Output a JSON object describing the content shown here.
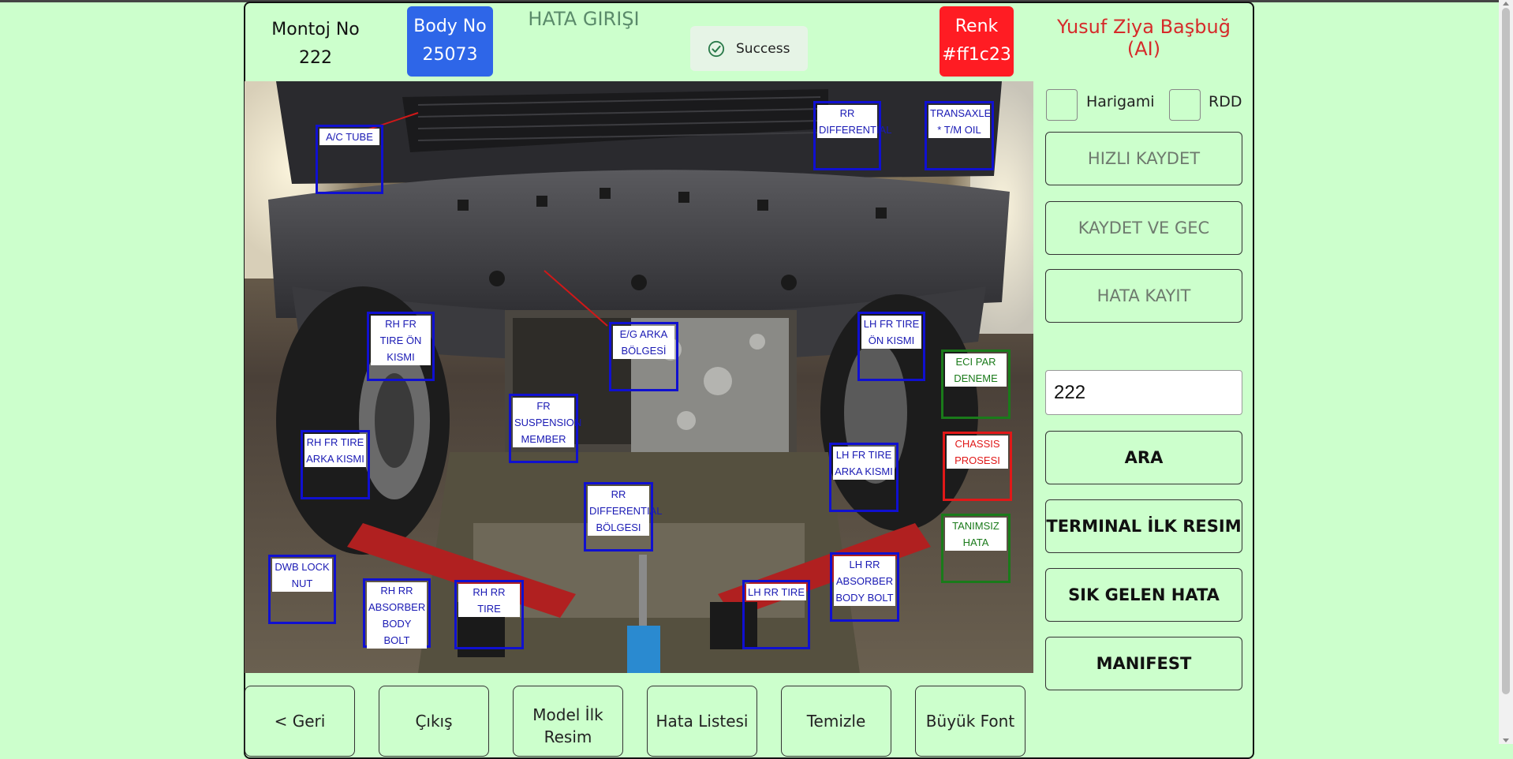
{
  "header": {
    "montoj_label": "Montoj No",
    "montoj_value": "222",
    "body_label": "Body No",
    "body_value": "25073",
    "title": "HATA GIRIŞI",
    "toast_text": "Success",
    "renk_label": "Renk",
    "renk_value": "#ff1c23",
    "user": "Yusuf Ziya Başbuğ (AI)"
  },
  "colors": {
    "page_bg": "#ccffcc",
    "body_badge": "#2e66e8",
    "renk_badge": "#ff1c23",
    "tag_blue": "#1010d0",
    "tag_green": "#1a7a1a",
    "tag_red": "#e01818"
  },
  "tags": {
    "ac_tube": "A/C TUBE",
    "rr_differential": "RR DIFFERENTIAL",
    "transaxle": "TRANSAXLE * T/M OIL",
    "rh_fr_tire_on": "RH FR TIRE ÖN KISMI",
    "eg_arka": "E/G ARKA BÖLGESİ",
    "lh_fr_tire_on": "LH FR TIRE ÖN KISMI",
    "eci_par": "ECI PAR DENEME",
    "fr_suspension": "FR SUSPENSION MEMBER",
    "rh_fr_tire_arka": "RH FR TIRE ARKA KISMI",
    "lh_fr_tire_arka": "LH FR TIRE ARKA KISMI",
    "chassis_prosesi": "CHASSIS PROSESI",
    "rr_diff_bolgesi": "RR DIFFERENTIAL BÖLGESI",
    "tanimsiz": "TANIMSIZ HATA",
    "dwb_lock": "DWB LOCK NUT",
    "rh_rr_absorber": "RH RR ABSORBER BODY BOLT",
    "rh_rr_tire": "RH RR TIRE",
    "lh_rr_tire": "LH RR TIRE",
    "lh_rr_absorber": "LH RR ABSORBER BODY BOLT"
  },
  "sidebar": {
    "harigami": "Harigami",
    "rdd": "RDD",
    "hizli_kaydet": "HIZLI KAYDET",
    "kaydet_gec": "KAYDET VE GEC",
    "hata_kayit": "HATA KAYIT",
    "search_value": "222",
    "ara": "ARA",
    "terminal": "TERMINAL İLK RESIM",
    "sik_gelen": "SIK GELEN HATA",
    "manifest": "MANIFEST"
  },
  "footer": {
    "geri": "< Geri",
    "cikis": "Çıkış",
    "model_ilk": "Model İlk Resim",
    "hata_listesi": "Hata Listesi",
    "temizle": "Temizle",
    "buyuk_font": "Büyük Font"
  }
}
